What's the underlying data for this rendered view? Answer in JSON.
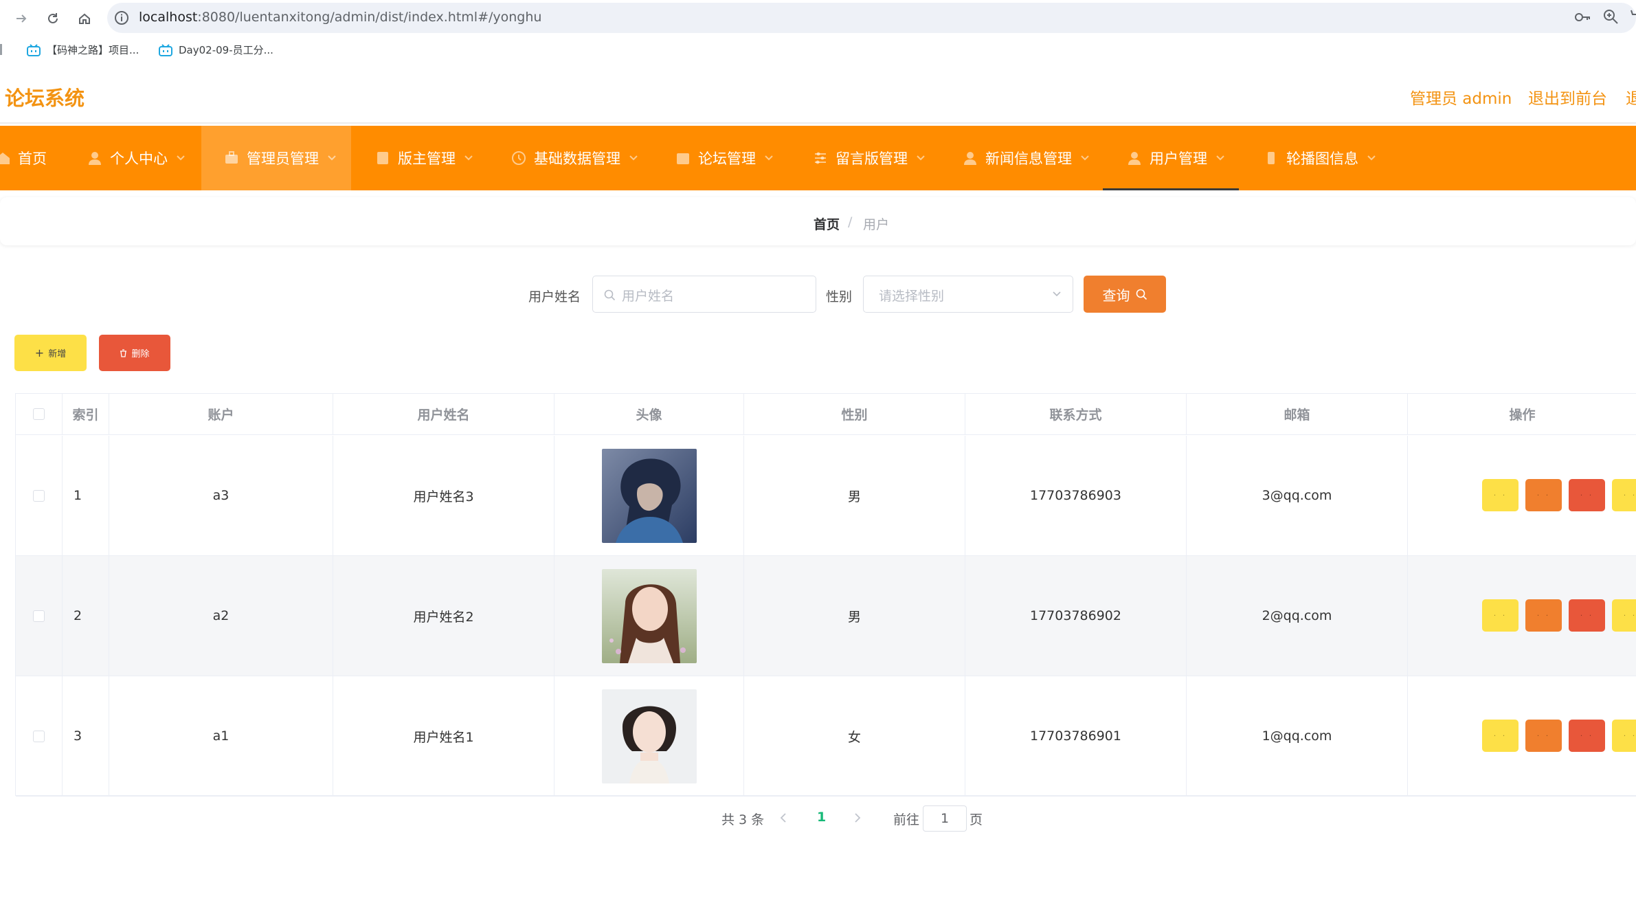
{
  "browser": {
    "url_host": "localhost",
    "url_path": ":8080/luentanxitong/admin/dist/index.html#/yonghu",
    "bookmarks": [
      {
        "label": "【码神之路】项目..."
      },
      {
        "label": "Day02-09-员工分..."
      }
    ]
  },
  "header": {
    "title": "论坛系统",
    "admin_label": "管理员 admin",
    "exit_label": "退出到前台",
    "clipped_label": "退"
  },
  "menu": {
    "items": [
      {
        "label": "首页"
      },
      {
        "label": "个人中心"
      },
      {
        "label": "管理员管理"
      },
      {
        "label": "版主管理"
      },
      {
        "label": "基础数据管理"
      },
      {
        "label": "论坛管理"
      },
      {
        "label": "留言版管理"
      },
      {
        "label": "新闻信息管理"
      },
      {
        "label": "用户管理"
      },
      {
        "label": "轮播图信息"
      }
    ]
  },
  "breadcrumb": {
    "home": "首页",
    "separator": "/",
    "current": "用户"
  },
  "search": {
    "name_label": "用户姓名",
    "name_placeholder": "用户姓名",
    "gender_label": "性别",
    "gender_placeholder": "请选择性别",
    "query_button": "查询"
  },
  "toolbar": {
    "add_button": "新增",
    "delete_button": "删除"
  },
  "table": {
    "columns": [
      "索引",
      "账户",
      "用户姓名",
      "头像",
      "性别",
      "联系方式",
      "邮箱",
      "操作"
    ],
    "rows": [
      {
        "index": "1",
        "account": "a3",
        "name": "用户姓名3",
        "gender": "男",
        "phone": "17703786903",
        "email": "3@qq.com"
      },
      {
        "index": "2",
        "account": "a2",
        "name": "用户姓名2",
        "gender": "男",
        "phone": "17703786902",
        "email": "2@qq.com"
      },
      {
        "index": "3",
        "account": "a1",
        "name": "用户姓名1",
        "gender": "女",
        "phone": "17703786901",
        "email": "1@qq.com"
      }
    ],
    "action_button_text": "· ·"
  },
  "pagination": {
    "total_text": "共 3 条",
    "current_page": "1",
    "goto_label": "前往",
    "goto_value": "1",
    "page_suffix": "页"
  },
  "colors": {
    "menu_bg": "#ff8c00",
    "title_orange": "#f39312",
    "btn_yellow": "#fde047",
    "btn_orange": "#f07f2e",
    "btn_red": "#e8573a",
    "pager_active": "#17b978"
  }
}
